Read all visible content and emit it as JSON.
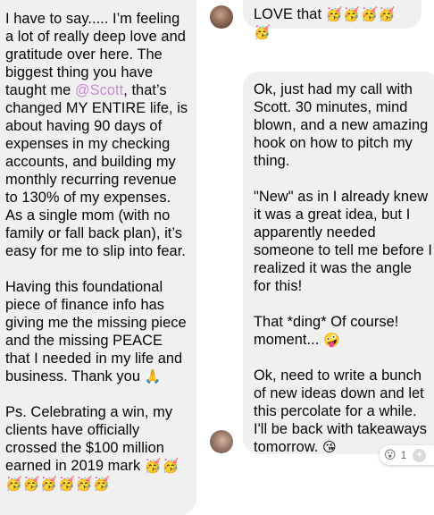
{
  "left_message": {
    "p1_before_mention": "I have to say..... I’m feeling a lot of really deep love and gratitude over here. The biggest thing you have taught me ",
    "mention": "@Scott",
    "p1_after_mention": ", that’s changed MY ENTIRE life, is about having 90 days of expenses in my checking accounts, and building my monthly recurring revenue to 130% of my expenses. As a single mom (with no family or fall back plan), it’s easy for me to slip into fear.",
    "p2": "Having this foundational piece of finance info has giving me the missing piece and the missing PEACE that I needed in my life and business. Thank you ",
    "p2_emoji": "🙏",
    "p3": "Ps. Celebrating a win, my clients have officially crossed the $100 million earned in 2019 mark ",
    "p3_emojis": "🥳🥳🥳🥳🥳🥳🥳🥳"
  },
  "love_message": {
    "text": "LOVE that ",
    "emojis": "🥳🥳🥳🥳🥳"
  },
  "right_message": {
    "p1": "Ok, just had my call with Scott. 30 minutes, mind blown, and a new amazing hook on how to pitch my thing.",
    "p2": "\"New\" as in I already knew it was a great idea, but I apparently needed someone to tell me before I realized it was the angle for this!",
    "p3": "That *ding* Of course! moment... ",
    "p3_emoji": "🤪",
    "p4": "Ok, need to write a bunch of new ideas down and let this percolate for a while. I'll be back with takeaways tomorrow. ",
    "p4_emoji": "😘"
  },
  "reaction": {
    "emoji": "😮",
    "count": "1",
    "add_icon": "+"
  },
  "colors": {
    "bubble": "#f0f0f0",
    "mention": "#c98bd2",
    "text": "#050505"
  }
}
